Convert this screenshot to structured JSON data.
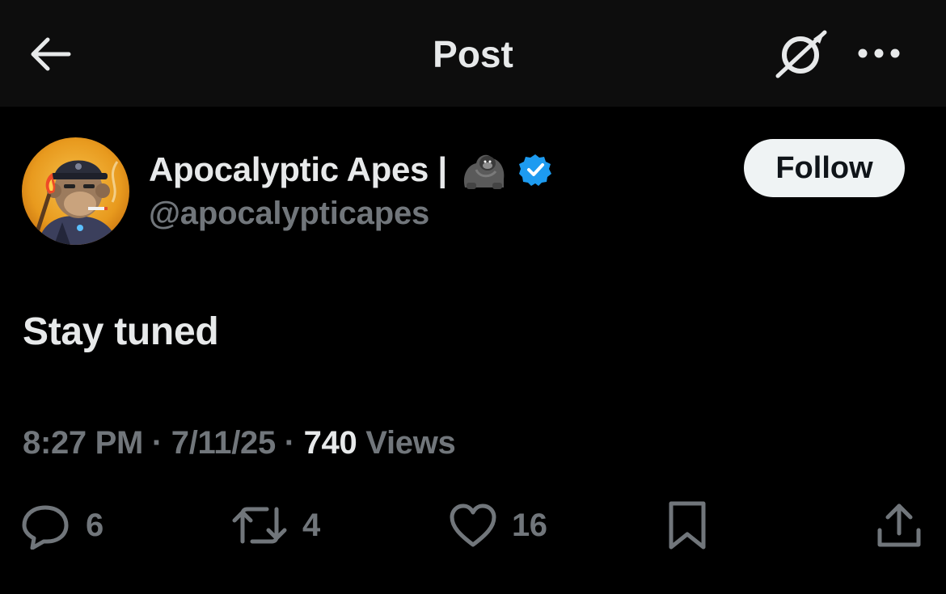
{
  "header": {
    "title": "Post",
    "back_icon": "arrow-left-icon",
    "grok_icon": "grok-icon",
    "more_icon": "more-horizontal-icon",
    "background_color": "#0d0d0d"
  },
  "author": {
    "display_name": "Apocalyptic Apes |",
    "name_emoji": "gorilla-emoji",
    "verified_color": "#1d9bf0",
    "handle": "@apocalypticapes",
    "avatar_icon": "ape-avatar"
  },
  "follow_button": {
    "label": "Follow"
  },
  "post": {
    "text": "Stay tuned"
  },
  "meta": {
    "time": "8:27 PM",
    "separator": "·",
    "date": "7/11/25",
    "views_count": "740",
    "views_label": "Views"
  },
  "actions": {
    "reply_count": "6",
    "repost_count": "4",
    "like_count": "16"
  },
  "colors": {
    "background": "#000000",
    "text_primary": "#e7e9ea",
    "text_secondary": "#71767b",
    "accent": "#1d9bf0"
  }
}
